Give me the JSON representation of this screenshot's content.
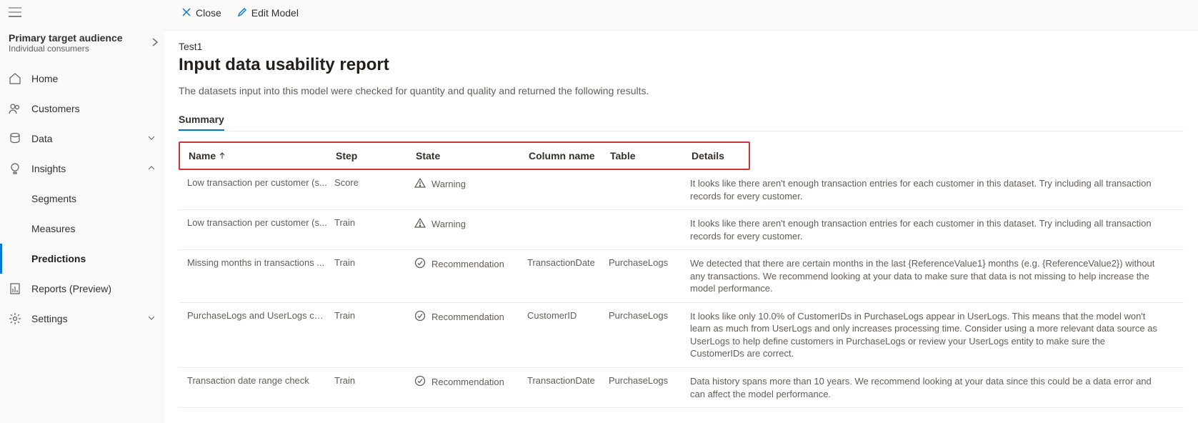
{
  "sidebar": {
    "audience_title": "Primary target audience",
    "audience_sub": "Individual consumers",
    "items": {
      "home": "Home",
      "customers": "Customers",
      "data": "Data",
      "insights": "Insights",
      "reports": "Reports (Preview)",
      "settings": "Settings"
    },
    "sub_items": {
      "segments": "Segments",
      "measures": "Measures",
      "predictions": "Predictions"
    }
  },
  "toolbar": {
    "close": "Close",
    "edit_model": "Edit Model"
  },
  "content": {
    "breadcrumb": "Test1",
    "title": "Input data usability report",
    "description": "The datasets input into this model were checked for quantity and quality and returned the following results.",
    "tab_summary": "Summary"
  },
  "table": {
    "headers": {
      "name": "Name",
      "step": "Step",
      "state": "State",
      "column": "Column name",
      "table": "Table",
      "details": "Details"
    },
    "rows": [
      {
        "name": "Low transaction per customer (s...",
        "step": "Score",
        "state_icon": "warning",
        "state": "Warning",
        "column": "",
        "table": "",
        "details": "It looks like there aren't enough transaction entries for each customer in this dataset. Try including all transaction records for every customer."
      },
      {
        "name": "Low transaction per customer (s...",
        "step": "Train",
        "state_icon": "warning",
        "state": "Warning",
        "column": "",
        "table": "",
        "details": "It looks like there aren't enough transaction entries for each customer in this dataset. Try including all transaction records for every customer."
      },
      {
        "name": "Missing months in transactions ...",
        "step": "Train",
        "state_icon": "recommendation",
        "state": "Recommendation",
        "column": "TransactionDate",
        "table": "PurchaseLogs",
        "details": "We detected that there are certain months in the last {ReferenceValue1} months (e.g. {ReferenceValue2}) without any transactions. We recommend looking at your data to make sure that data is not missing to help increase the model performance."
      },
      {
        "name": "PurchaseLogs and UserLogs cus...",
        "step": "Train",
        "state_icon": "recommendation",
        "state": "Recommendation",
        "column": "CustomerID",
        "table": "PurchaseLogs",
        "details": "It looks like only 10.0% of CustomerIDs in PurchaseLogs appear in UserLogs. This means that the model won't learn as much from UserLogs and only increases processing time. Consider using a more relevant data source as UserLogs to help define customers in PurchaseLogs or review your UserLogs entity to make sure the CustomerIDs are correct."
      },
      {
        "name": "Transaction date range check",
        "step": "Train",
        "state_icon": "recommendation",
        "state": "Recommendation",
        "column": "TransactionDate",
        "table": "PurchaseLogs",
        "details": "Data history spans more than 10 years. We recommend looking at your data since this could be a data error and can affect the model performance."
      }
    ]
  }
}
